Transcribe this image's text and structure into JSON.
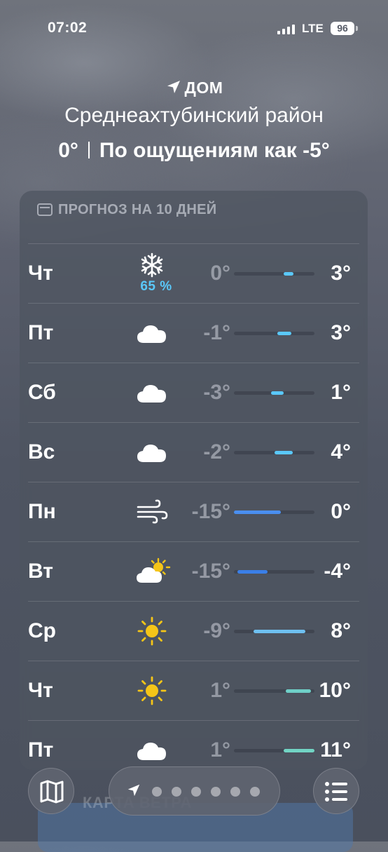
{
  "status_bar": {
    "time": "07:02",
    "network": "LTE",
    "battery": "96"
  },
  "header": {
    "location_label": "ДОМ",
    "region": "Среднеахтубинский район",
    "current_temp": "0°",
    "feels_like": "По ощущениям как -5°"
  },
  "forecast": {
    "title": "ПРОГНОЗ НА 10 ДНЕЙ",
    "days": [
      {
        "day": "Чт",
        "icon": "snowflake-icon",
        "precip": "65 %",
        "low": "0°",
        "high": "3°",
        "range_start": 0.62,
        "range_end": 0.74,
        "bar_color": "#5ac8fa",
        "low_dim": true
      },
      {
        "day": "Пт",
        "icon": "cloud-icon",
        "precip": "",
        "low": "-1°",
        "high": "3°",
        "range_start": 0.54,
        "range_end": 0.71,
        "bar_color": "#5ac8fa",
        "low_dim": true
      },
      {
        "day": "Сб",
        "icon": "cloud-icon",
        "precip": "",
        "low": "-3°",
        "high": "1°",
        "range_start": 0.46,
        "range_end": 0.62,
        "bar_color": "#5ac8fa",
        "low_dim": true
      },
      {
        "day": "Вс",
        "icon": "cloud-icon",
        "precip": "",
        "low": "-2°",
        "high": "4°",
        "range_start": 0.5,
        "range_end": 0.73,
        "bar_color": "#5ac8fa",
        "low_dim": true
      },
      {
        "day": "Пн",
        "icon": "wind-icon",
        "precip": "",
        "low": "-15°",
        "high": "0°",
        "range_start": 0.0,
        "range_end": 0.58,
        "bar_color": "#4a8ff0",
        "low_dim": true
      },
      {
        "day": "Вт",
        "icon": "partly-sunny-icon",
        "precip": "",
        "low": "-15°",
        "high": "-4°",
        "range_start": 0.04,
        "range_end": 0.42,
        "bar_color": "#3a7fe8",
        "low_dim": true
      },
      {
        "day": "Ср",
        "icon": "sun-icon",
        "precip": "",
        "low": "-9°",
        "high": "8°",
        "range_start": 0.24,
        "range_end": 0.89,
        "bar_color": "#6ec0f0",
        "low_dim": true
      },
      {
        "day": "Чт",
        "icon": "sun-icon",
        "precip": "",
        "low": "1°",
        "high": "10°",
        "range_start": 0.64,
        "range_end": 0.96,
        "bar_color": "#6fd0c8",
        "low_dim": true
      },
      {
        "day": "Пт",
        "icon": "cloud-icon",
        "precip": "",
        "low": "1°",
        "high": "11°",
        "range_start": 0.62,
        "range_end": 1.0,
        "bar_color": "#72d4c4",
        "low_dim": true
      }
    ]
  },
  "bottom_bar": {
    "map_peek_title": "КАРТА ВЕТРА",
    "page_dots": 6
  }
}
